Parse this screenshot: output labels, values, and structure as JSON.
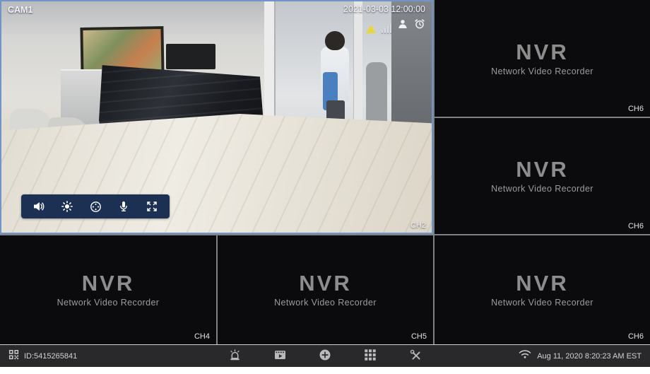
{
  "app": {
    "type": "nvr-live-view"
  },
  "colors": {
    "selected_border": "#7194c8",
    "toolbar_bg": "#1c3054",
    "statusbar_bg": "#29292b",
    "cell_bg": "#0b0b0d",
    "warning_yellow": "#e8d63f",
    "nvr_logo_gray": "#8d8d8d"
  },
  "main_feed": {
    "camera_label": "CAM1",
    "timestamp": "2021-03-03 12:00:00",
    "channel_label": "CH2",
    "status_icons": [
      "warning-triangle-icon",
      "signal-bars-icon",
      "person-detect-icon",
      "alarm-clock-icon"
    ],
    "toolbar_icons": [
      "speaker-icon",
      "brightness-icon",
      "ptz-control-icon",
      "microphone-icon",
      "fullscreen-icon"
    ]
  },
  "placeholder_cells": [
    {
      "logo": "NVR",
      "subtitle": "Network Video Recorder",
      "channel_label": "CH6"
    },
    {
      "logo": "NVR",
      "subtitle": "Network Video Recorder",
      "channel_label": "CH6"
    },
    {
      "logo": "NVR",
      "subtitle": "Network Video Recorder",
      "channel_label": "CH4"
    },
    {
      "logo": "NVR",
      "subtitle": "Network Video Recorder",
      "channel_label": "CH5"
    },
    {
      "logo": "NVR",
      "subtitle": "Network Video Recorder",
      "channel_label": "CH6"
    }
  ],
  "status_bar": {
    "left_icon": "qr-code-icon",
    "device_id": "ID:5415265841",
    "center_icons": [
      "alarm-icon",
      "playback-icon",
      "add-device-icon",
      "grid-view-icon",
      "tools-icon"
    ],
    "right_icon": "wifi-icon",
    "datetime": "Aug 11, 2020 8:20:23 AM EST"
  }
}
